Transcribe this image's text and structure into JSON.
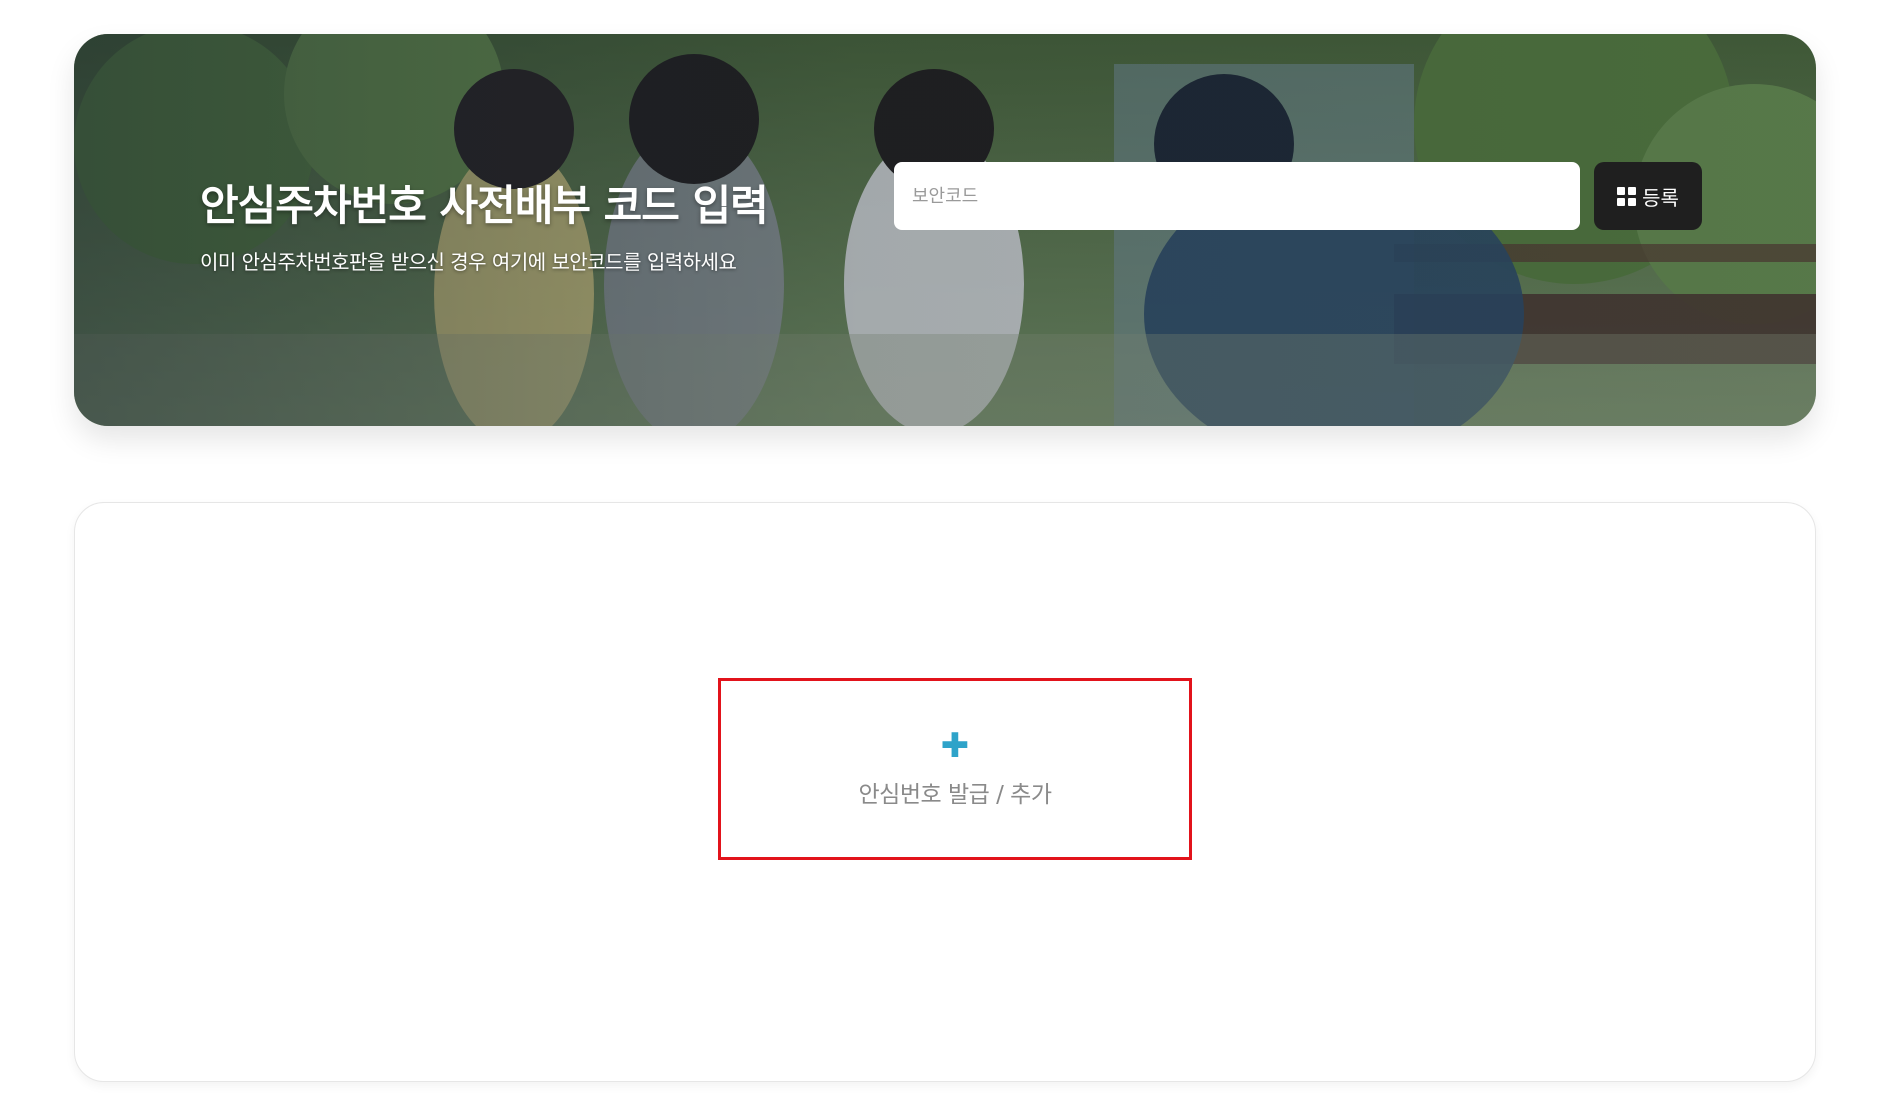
{
  "hero": {
    "title": "안심주차번호 사전배부 코드 입력",
    "subtitle": "이미 안심주차번호판을 받으신 경우 여기에 보안코드를 입력하세요",
    "input_placeholder": "보안코드",
    "input_value": "",
    "register_label": "등록",
    "register_icon": "grid-icon"
  },
  "card": {
    "add_icon": "plus-icon",
    "add_label": "안심번호 발급 / 추가"
  },
  "colors": {
    "accent": "#2ea3c9",
    "highlight_border": "#e2131b",
    "button_bg": "#1f1f1f"
  }
}
